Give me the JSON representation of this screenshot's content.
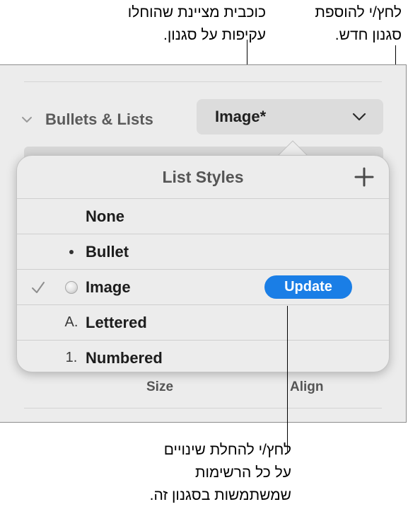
{
  "callouts": {
    "star": [
      "כוכבית מציינת שהוחלו",
      "עקיפות על סגנון."
    ],
    "add": [
      "לחץ/י להוספת",
      "סגנון חדש."
    ],
    "update": [
      "לחץ/י להחלת שינויים",
      "על כל הרשימות",
      "שמשתמשות בסגנון זה."
    ]
  },
  "section": {
    "title": "Bullets & Lists",
    "style_value": "Image*"
  },
  "popover": {
    "title": "List Styles",
    "items": [
      {
        "label": "None",
        "marker": "",
        "checked": false
      },
      {
        "label": "Bullet",
        "marker": "bullet-dot",
        "checked": false
      },
      {
        "label": "Image",
        "marker": "image-dot",
        "checked": true,
        "action": "Update"
      },
      {
        "label": "Lettered",
        "marker": "A.",
        "checked": false
      },
      {
        "label": "Numbered",
        "marker": "1.",
        "checked": false
      }
    ]
  },
  "bottom": {
    "size_label": "Size",
    "align_label": "Align"
  },
  "colors": {
    "accent": "#1a7ee6",
    "panel": "#ececec"
  }
}
